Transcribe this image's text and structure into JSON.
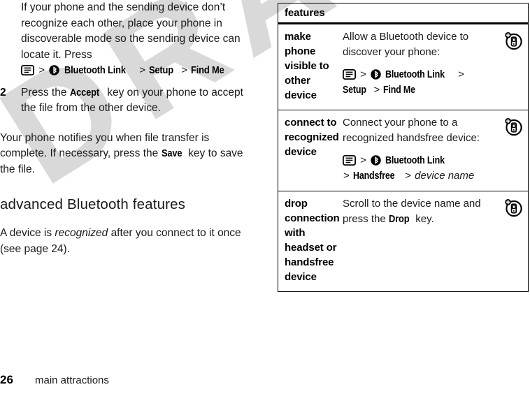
{
  "watermark": {
    "text": "DRAFT"
  },
  "left_column": {
    "paragraph_1": "If your phone and the sending device don’t recognize each other, place your phone in discoverable mode so the sending device can locate it. Press",
    "path_1": {
      "menu_icon": "menu-key-icon",
      "sep": ">",
      "bluetooth_icon": "bluetooth-icon",
      "item_1": "Bluetooth Link",
      "item_2": "Setup",
      "item_3": "Find Me"
    },
    "step_2": {
      "number": "2",
      "text_before": "Press the",
      "key": "Accept",
      "text_after": "key on your phone to accept the file from the other device."
    },
    "paragraph_2": {
      "text_before": "Your phone notifies you when file transfer is complete. If necessary, press the",
      "key": "Save",
      "text_after": "key to save the file."
    },
    "section_heading": "advanced Bluetooth features",
    "paragraph_3": {
      "text_before": "A device is",
      "italic": "recognized",
      "text_after": "after you connect to it once (see page 24)."
    }
  },
  "features_table": {
    "header": "features",
    "rows": [
      {
        "name": "make phone visible to other device",
        "description": "Allow a Bluetooth device to discover your phone:",
        "path": {
          "menu_icon": "menu-key-icon",
          "sep": ">",
          "bluetooth_icon": "bluetooth-icon",
          "item_1": "Bluetooth Link",
          "item_2": "Setup",
          "item_3": "Find Me"
        },
        "icon": "phone-plus-icon"
      },
      {
        "name": "connect to recognized device",
        "description": "Connect your phone to a recognized handsfree device:",
        "path": {
          "menu_icon": "menu-key-icon",
          "sep": ">",
          "bluetooth_icon": "bluetooth-icon",
          "item_1": "Bluetooth Link",
          "item_2": "Handsfree",
          "item_3_italic": "device name"
        },
        "icon": "phone-plus-icon"
      },
      {
        "name": "drop connection with headset or handsfree device",
        "description_before": "Scroll to the device name and press the",
        "description_key": "Drop",
        "description_after": "key.",
        "icon": "phone-plus-icon"
      }
    ]
  },
  "footer": {
    "page_number": "26",
    "title": "main attractions"
  },
  "colors": {
    "text": "#1a1a1a",
    "rule": "#000000",
    "watermark": "#d9d9d9",
    "background": "#ffffff"
  }
}
